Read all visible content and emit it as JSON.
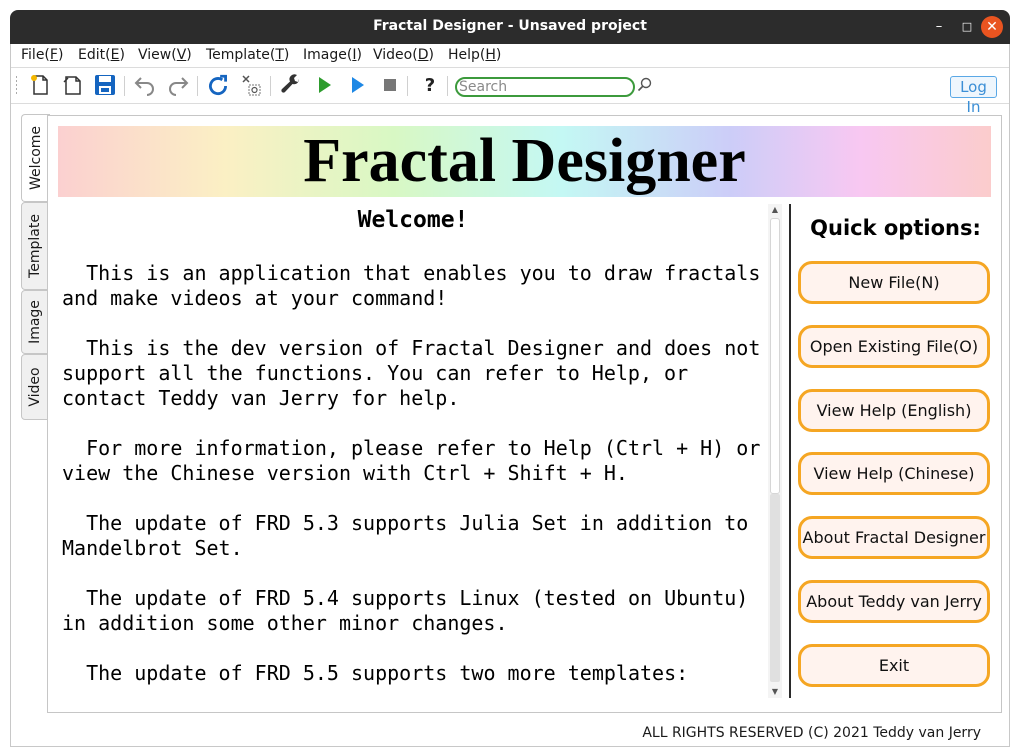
{
  "window": {
    "title": "Fractal Designer - Unsaved project",
    "minimize_glyph": "–",
    "maximize_glyph": "□",
    "close_glyph": "✕"
  },
  "menu": [
    {
      "label": "File(F)"
    },
    {
      "label": "Edit(E)"
    },
    {
      "label": "View(V)"
    },
    {
      "label": "Template(T)"
    },
    {
      "label": "Image(I)"
    },
    {
      "label": "Video(D)"
    },
    {
      "label": "Help(H)"
    }
  ],
  "toolbar": {
    "icons": [
      "new-file-icon",
      "open-file-icon",
      "save-icon",
      "undo-icon",
      "redo-icon",
      "refresh-icon",
      "clear-icon",
      "settings-wrench-icon",
      "run-icon",
      "run-next-icon",
      "stop-icon",
      "help-icon"
    ],
    "help_glyph": "?",
    "search_placeholder": "Search",
    "login_label": "Log In",
    "colors": {
      "run": "#2e9c2e",
      "run_next": "#1e88e5",
      "save": "#1565c0",
      "refresh": "#1565c0",
      "search_border": "#3c9a3c",
      "login": "#3b8fd6"
    }
  },
  "tabs": [
    {
      "label": "Welcome",
      "active": true
    },
    {
      "label": "Template",
      "active": false
    },
    {
      "label": "Image",
      "active": false
    },
    {
      "label": "Video",
      "active": false
    }
  ],
  "banner": {
    "title": "Fractal Designer"
  },
  "welcome": {
    "heading": "Welcome!",
    "paragraphs": [
      "  This is an application that enables you to draw fractals and make videos at your command!",
      "  This is the dev version of Fractal Designer and does not support all the functions. You can refer to Help, or contact Teddy van Jerry for help.",
      "  For more information, please refer to Help (Ctrl + H) or view the Chinese version with Ctrl + Shift + H.",
      "  The update of FRD 5.3 supports Julia Set in addition to Mandelbrot Set.",
      "  The update of FRD 5.4 supports Linux (tested on Ubuntu) in addition some other minor changes.",
      "  The update of FRD 5.5 supports two more templates:"
    ]
  },
  "quick_options": {
    "title": "Quick options:",
    "buttons": [
      {
        "label": "New File(N)"
      },
      {
        "label": "Open Existing File(O)"
      },
      {
        "label": "View Help (English)"
      },
      {
        "label": "View Help (Chinese)"
      },
      {
        "label": "About Fractal Designer"
      },
      {
        "label": "About Teddy van Jerry"
      },
      {
        "label": "Exit"
      }
    ],
    "button_border_color": "#f5a623",
    "button_fill_color": "#fff3ee"
  },
  "footer": {
    "text": "ALL RIGHTS RESERVED (C) 2021 Teddy van Jerry"
  }
}
